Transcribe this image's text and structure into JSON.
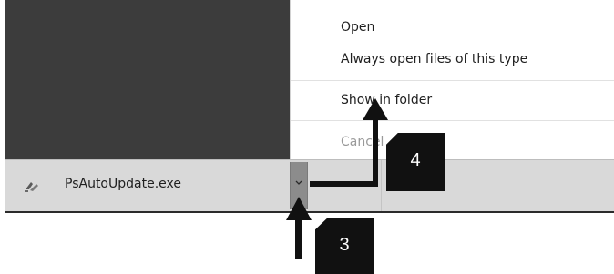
{
  "context_menu": {
    "items": [
      {
        "label": "Open",
        "enabled": true
      },
      {
        "label": "Always open files of this type",
        "enabled": true
      },
      {
        "label": "Show in folder",
        "enabled": true
      },
      {
        "label": "Cancel",
        "enabled": false
      }
    ]
  },
  "download_bar": {
    "file_name": "PsAutoUpdate.exe",
    "file_icon": "installer-icon",
    "menu_button_icon": "chevron-down-icon"
  },
  "annotations": {
    "step3_label": "3",
    "step4_label": "4"
  },
  "colors": {
    "dark_background": "#3c3c3c",
    "download_bar": "#d9d9d9",
    "callout": "#111111"
  }
}
